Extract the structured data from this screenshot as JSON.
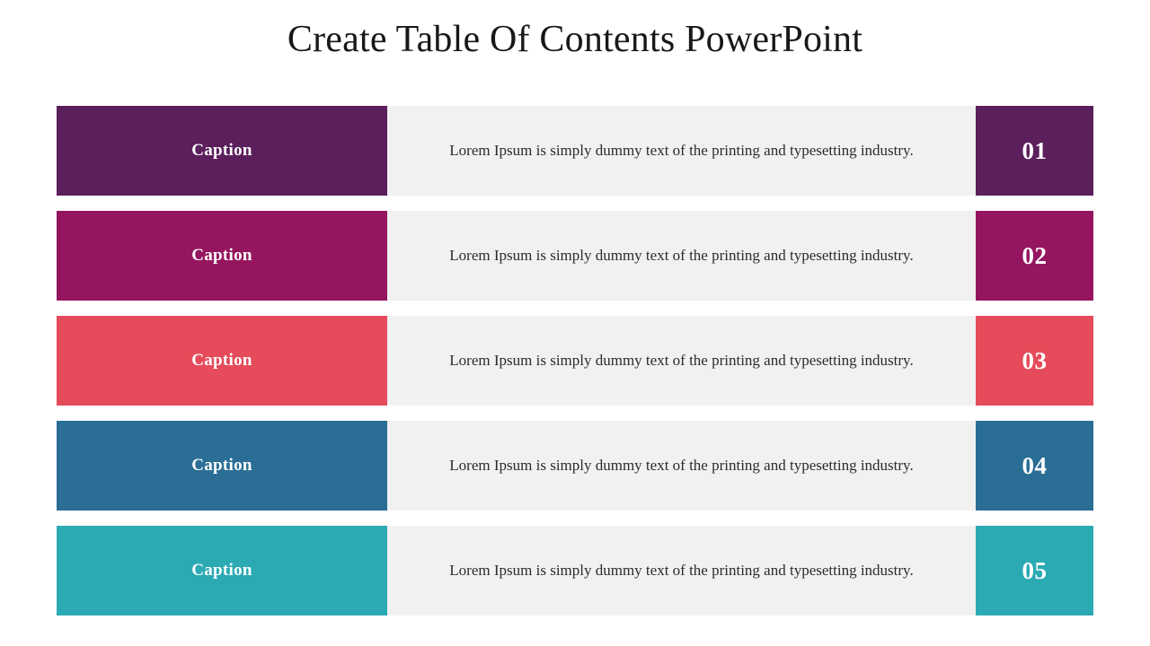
{
  "slide": {
    "title": "Create Table Of Contents PowerPoint",
    "background_color": "#FFFFFF",
    "title_color": "#181818",
    "panel_color": "#F1F1F1",
    "body_text_color": "#2B2B2B",
    "label_text_color": "#FFFFFF"
  },
  "toc": {
    "rows": [
      {
        "caption": "Caption",
        "description": "Lorem Ipsum is simply dummy text of the printing and typesetting industry.",
        "number": "01",
        "color": "#5B1F5B"
      },
      {
        "caption": "Caption",
        "description": "Lorem Ipsum is simply dummy text of the printing and typesetting industry.",
        "number": "02",
        "color": "#95165F"
      },
      {
        "caption": "Caption",
        "description": "Lorem Ipsum is simply dummy text of the printing and typesetting industry.",
        "number": "03",
        "color": "#E54B5A"
      },
      {
        "caption": "Caption",
        "description": "Lorem Ipsum is simply dummy text of the printing and typesetting industry.",
        "number": "04",
        "color": "#2A6E96"
      },
      {
        "caption": "Caption",
        "description": "Lorem Ipsum is simply dummy text of the printing and typesetting industry.",
        "number": "05",
        "color": "#2BAAB4"
      }
    ]
  }
}
